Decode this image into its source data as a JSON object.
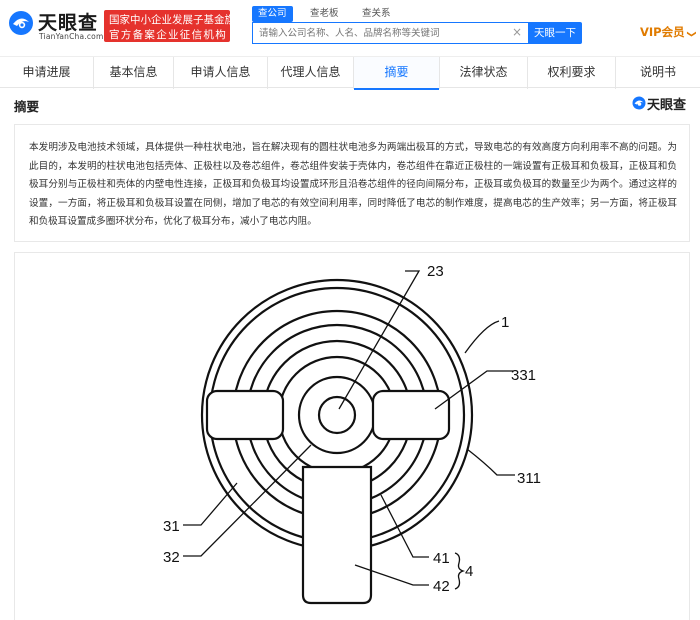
{
  "header": {
    "logo_text": "天眼查",
    "logo_sub": "TianYanCha.com",
    "badge_line1": "国家中小企业发展子基金旗下",
    "badge_line2": "官方备案企业征信机构",
    "search_tabs": [
      "查公司",
      "查老板",
      "查关系"
    ],
    "search_placeholder": "请输入公司名称、人名、品牌名称等关键词",
    "search_clear": "×",
    "search_button": "天眼一下",
    "vip_label": "VIP会员",
    "vip_chevron": "❯",
    "brand_color": "#1677ff",
    "badge_color": "#e5322d",
    "vip_color": "#e07b00"
  },
  "tabs": [
    {
      "label": "申请进展",
      "active": false
    },
    {
      "label": "基本信息",
      "active": false
    },
    {
      "label": "申请人信息",
      "active": false
    },
    {
      "label": "代理人信息",
      "active": false
    },
    {
      "label": "摘要",
      "active": true
    },
    {
      "label": "法律状态",
      "active": false
    },
    {
      "label": "权利要求",
      "active": false
    },
    {
      "label": "说明书",
      "active": false
    }
  ],
  "section": {
    "title": "摘要",
    "watermark": "天眼查"
  },
  "abstract_text": "本发明涉及电池技术领域，具体提供一种柱状电池，旨在解决现有的圆柱状电池多为两端出极耳的方式，导致电芯的有效高度方向利用率不高的问题。为此目的，本发明的柱状电池包括壳体、正极柱以及卷芯组件，卷芯组件安装于壳体内，卷芯组件在靠近正极柱的一端设置有正极耳和负极耳，正极耳和负极耳分别与正极柱和壳体的内壁电性连接，正极耳和负极耳均设置成环形且沿卷芯组件的径向间隔分布，正极耳或负极耳的数量至少为两个。通过这样的设置，一方面，将正极耳和负极耳设置在同侧，增加了电芯的有效空间利用率，同时降低了电芯的制作难度，提高电芯的生产效率；另一方面，将正极耳和负极耳设置成多圈环状分布，优化了极耳分布，减小了电芯内阻。",
  "figure": {
    "labels": {
      "l23": "23",
      "l1": "1",
      "l331": "331",
      "l311": "311",
      "l31": "31",
      "l32": "32",
      "l41": "41",
      "l42": "42",
      "l4": "4"
    }
  }
}
